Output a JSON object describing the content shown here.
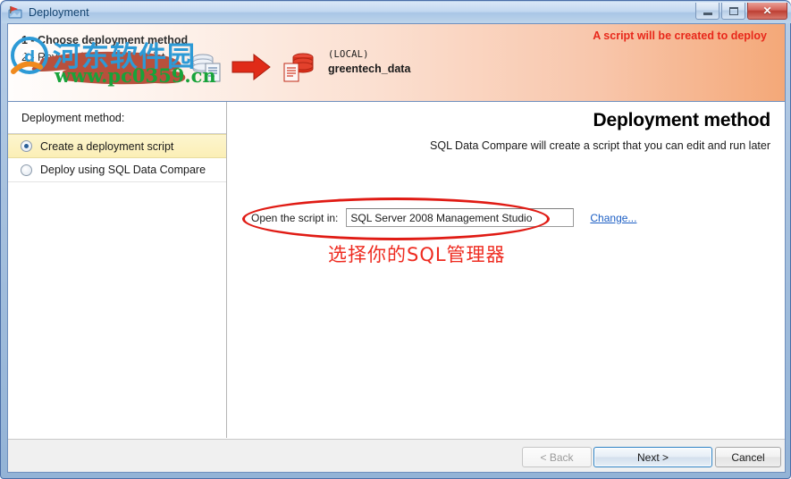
{
  "window": {
    "title": "Deployment",
    "icon": "deployment-icon",
    "minimize_label": "Minimize",
    "maximize_label": "Maximize",
    "close_label": "✕"
  },
  "banner": {
    "steps": [
      {
        "label": "1 - Choose deployment method",
        "current": true
      },
      {
        "label": "2 - Review deployment script",
        "current": false
      }
    ],
    "warning": "A script will be created to deploy",
    "source_icon": "database-source-icon",
    "arrow_icon": "arrow-right-icon",
    "target_icon": "database-target-icon",
    "target_server": "(LOCAL)",
    "target_database": "greentech_data",
    "redaction_mark": "brush-stroke-redaction",
    "gradient_start": "#fffdfc",
    "gradient_end": "#f4a878"
  },
  "watermark": {
    "site_name": "河东软件园",
    "url": "www.pc0359.cn",
    "logo": "hedong-logo",
    "site_color": "#2d9ad6",
    "url_color": "#18a33a"
  },
  "sidebar": {
    "header": "Deployment method:",
    "options": [
      {
        "label": "Create a deployment script",
        "selected": true
      },
      {
        "label": "Deploy using SQL Data Compare",
        "selected": false
      }
    ]
  },
  "content": {
    "title": "Deployment method",
    "subtitle": "SQL Data Compare will create a script that you can edit and run later",
    "form": {
      "label": "Open the script in:",
      "value": "SQL Server 2008 Management Studio",
      "placeholder": "SQL Server 2008 Management Studio",
      "change_link": "Change..."
    }
  },
  "annotations": {
    "ellipse": "red-highlight-ellipse",
    "caption": "选择你的SQL管理器",
    "color": "#ee2b20"
  },
  "footer": {
    "back": "< Back",
    "next": "Next >",
    "cancel": "Cancel"
  }
}
